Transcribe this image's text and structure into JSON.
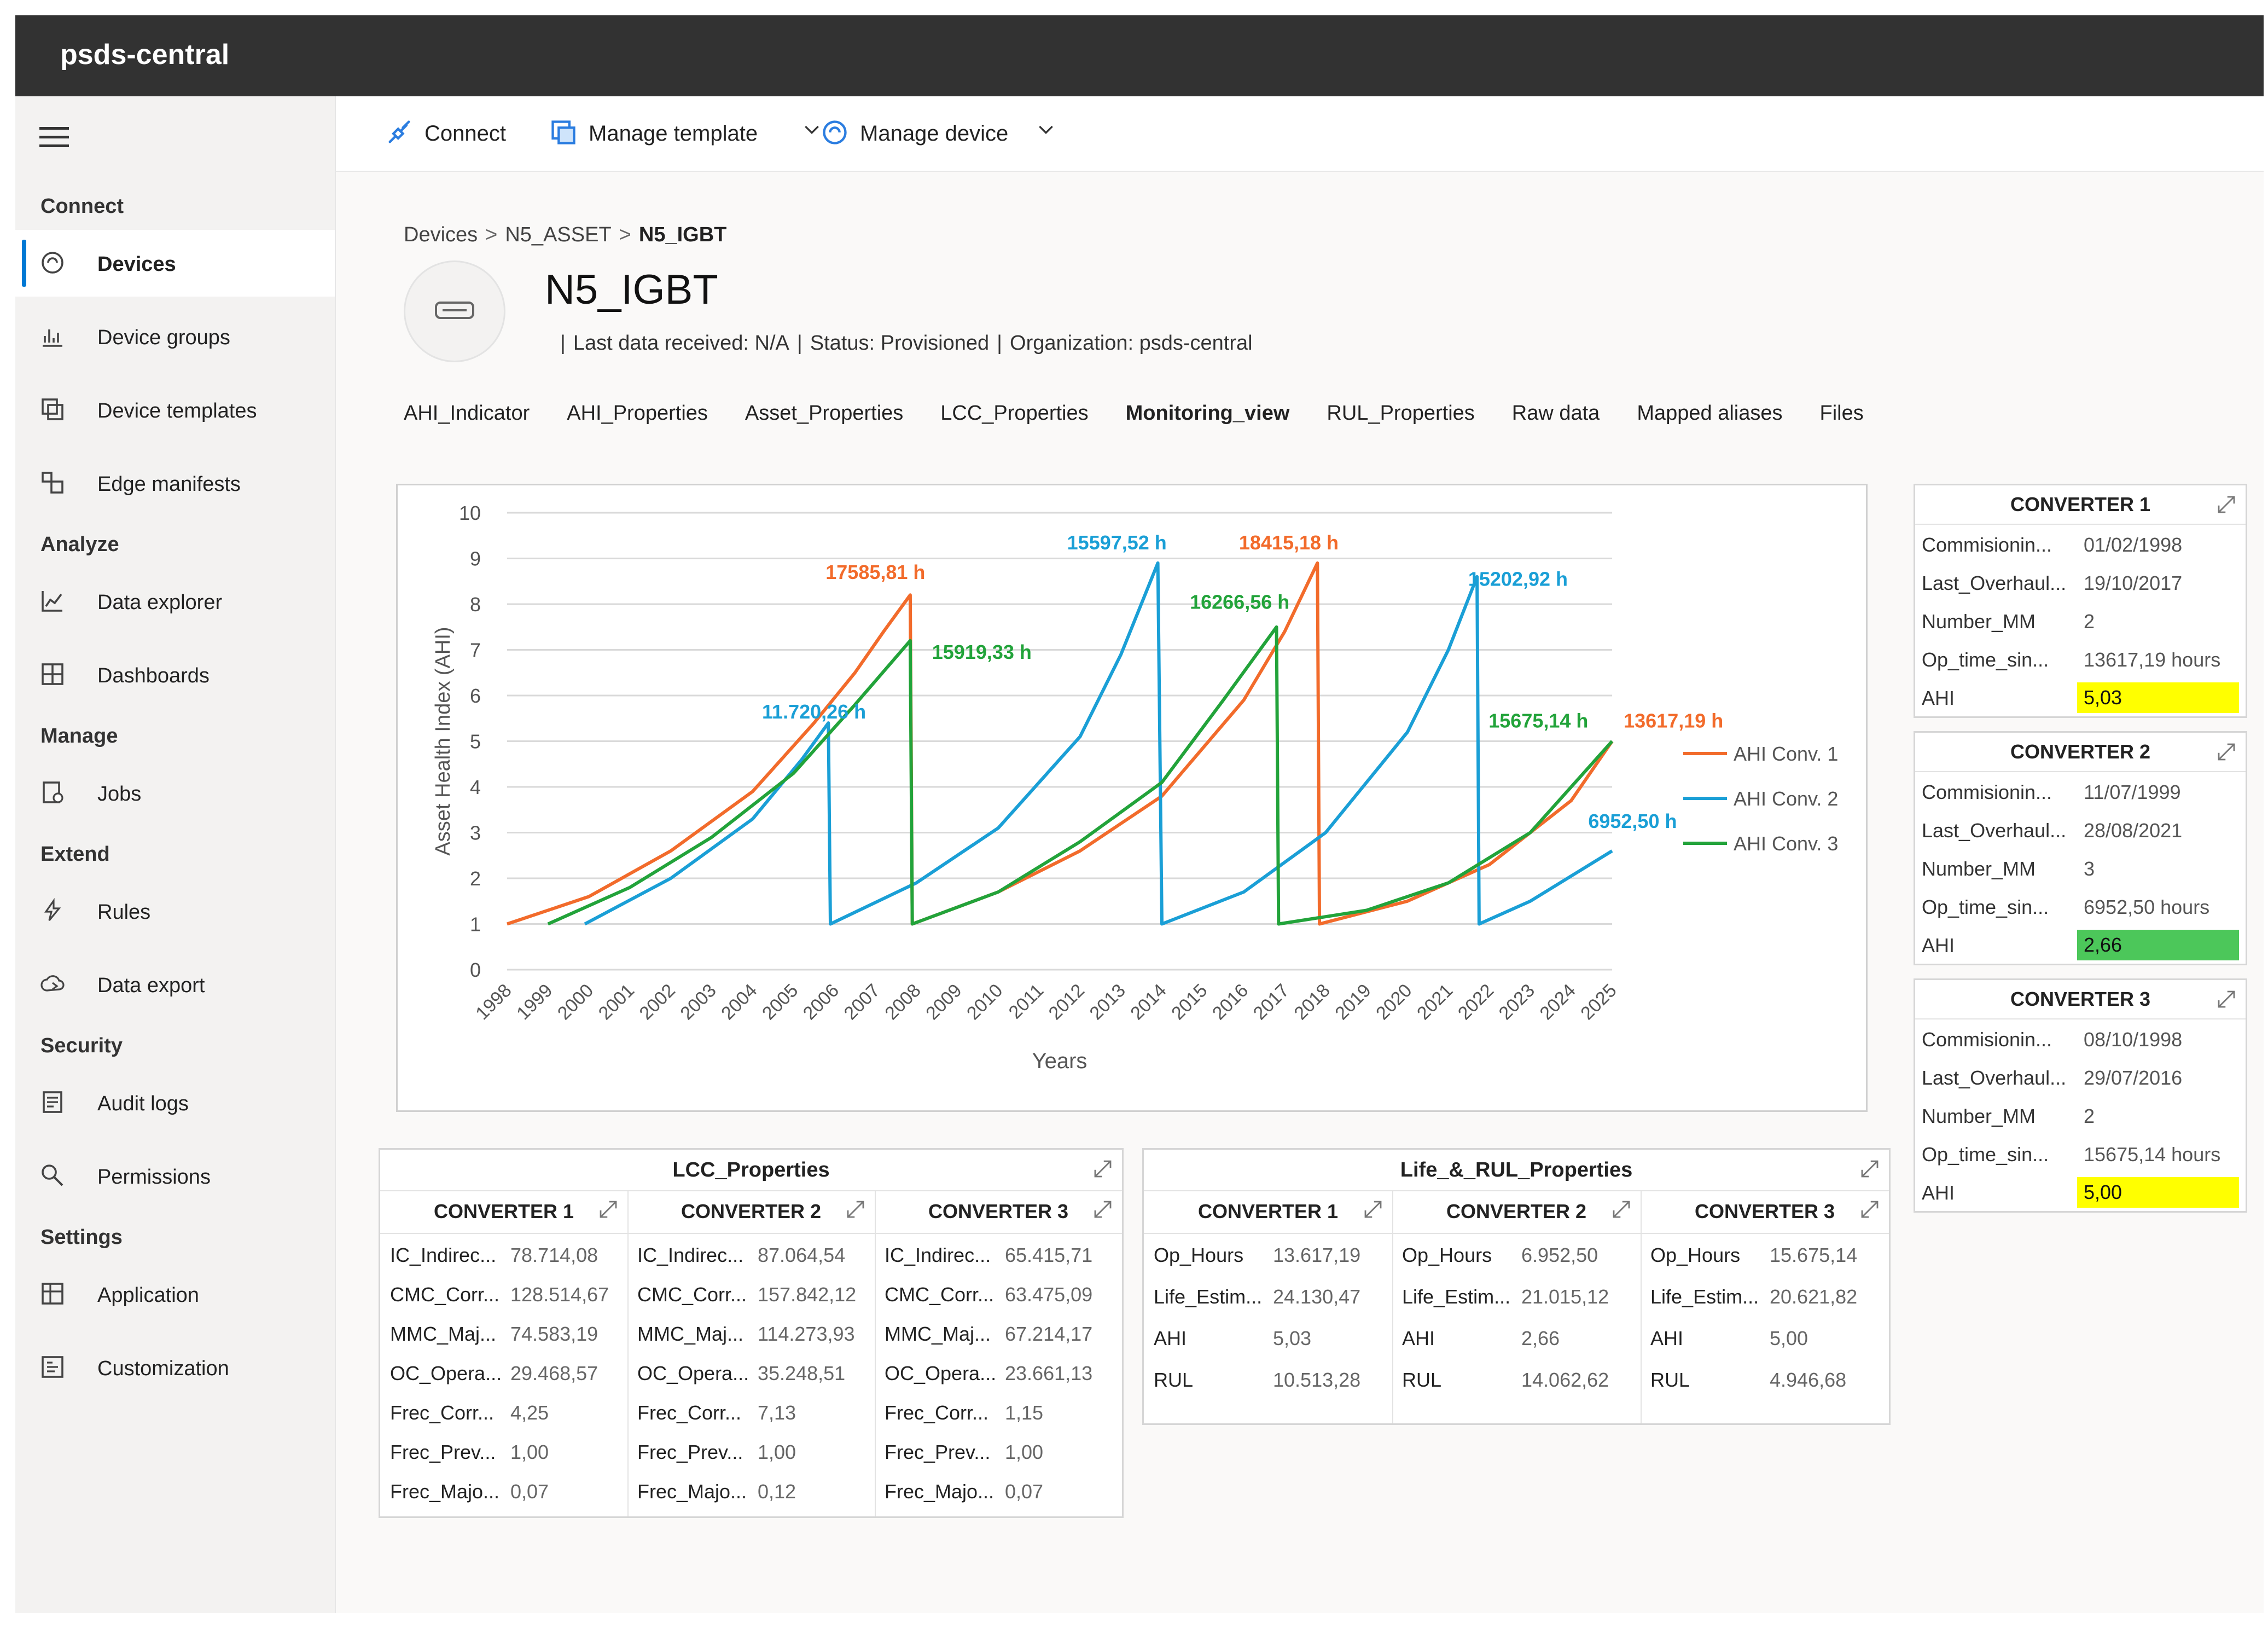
{
  "app": {
    "title": "psds-central"
  },
  "sidebar": {
    "sections": [
      {
        "label": "Connect",
        "items": [
          {
            "label": "Devices",
            "icon": "devices-icon",
            "active": true
          },
          {
            "label": "Device groups",
            "icon": "device-groups-icon"
          },
          {
            "label": "Device templates",
            "icon": "device-templates-icon"
          },
          {
            "label": "Edge manifests",
            "icon": "edge-manifests-icon"
          }
        ]
      },
      {
        "label": "Analyze",
        "items": [
          {
            "label": "Data explorer",
            "icon": "data-explorer-icon"
          },
          {
            "label": "Dashboards",
            "icon": "dashboards-icon"
          }
        ]
      },
      {
        "label": "Manage",
        "items": [
          {
            "label": "Jobs",
            "icon": "jobs-icon"
          }
        ]
      },
      {
        "label": "Extend",
        "items": [
          {
            "label": "Rules",
            "icon": "rules-icon"
          },
          {
            "label": "Data export",
            "icon": "data-export-icon"
          }
        ]
      },
      {
        "label": "Security",
        "items": [
          {
            "label": "Audit logs",
            "icon": "audit-logs-icon"
          },
          {
            "label": "Permissions",
            "icon": "permissions-icon"
          }
        ]
      },
      {
        "label": "Settings",
        "items": [
          {
            "label": "Application",
            "icon": "application-icon"
          },
          {
            "label": "Customization",
            "icon": "customization-icon"
          }
        ]
      }
    ]
  },
  "toolbar": {
    "connect": "Connect",
    "manage_template": "Manage template",
    "manage_device": "Manage device"
  },
  "breadcrumb": {
    "root": "Devices",
    "parent": "N5_ASSET",
    "current": "N5_IGBT"
  },
  "device": {
    "name": "N5_IGBT",
    "last_data": "Last data received: N/A",
    "status": "Status: Provisioned",
    "organization": "Organization: psds-central"
  },
  "tabs": [
    "AHI_Indicator",
    "AHI_Properties",
    "Asset_Properties",
    "LCC_Properties",
    "Monitoring_view",
    "RUL_Properties",
    "Raw data",
    "Mapped aliases",
    "Files"
  ],
  "active_tab": "Monitoring_view",
  "chart_data": {
    "type": "line",
    "ylabel": "Asset Health Index (AHI)",
    "xlabel": "Years",
    "ylim": [
      0,
      10
    ],
    "yticks": [
      0,
      1,
      2,
      3,
      4,
      5,
      6,
      7,
      8,
      9,
      10
    ],
    "xticks": [
      "1998",
      "1999",
      "2000",
      "2001",
      "2002",
      "2003",
      "2004",
      "2005",
      "2006",
      "2007",
      "2008",
      "2009",
      "2010",
      "2011",
      "2012",
      "2013",
      "2014",
      "2015",
      "2016",
      "2017",
      "2018",
      "2019",
      "2020",
      "2021",
      "2022",
      "2023",
      "2024",
      "2025"
    ],
    "grid": "horizontal",
    "legend_position": "right",
    "series": [
      {
        "name": "AHI Conv. 1",
        "color": "#f26b2b",
        "points": [
          [
            1998.0,
            1.0
          ],
          [
            2000.0,
            1.6
          ],
          [
            2002.0,
            2.6
          ],
          [
            2004.0,
            3.9
          ],
          [
            2005.5,
            5.4
          ],
          [
            2006.5,
            6.5
          ],
          [
            2007.2,
            7.4
          ],
          [
            2007.85,
            8.2
          ],
          [
            2007.9,
            1.0
          ],
          [
            2010.0,
            1.7
          ],
          [
            2012.0,
            2.6
          ],
          [
            2014.0,
            3.8
          ],
          [
            2016.0,
            5.9
          ],
          [
            2017.0,
            7.4
          ],
          [
            2017.8,
            8.9
          ],
          [
            2017.85,
            1.0
          ],
          [
            2020.0,
            1.5
          ],
          [
            2022.0,
            2.3
          ],
          [
            2024.0,
            3.7
          ],
          [
            2025.0,
            5.0
          ]
        ]
      },
      {
        "name": "AHI Conv. 2",
        "color": "#1a9fd6",
        "points": [
          [
            1999.9,
            1.0
          ],
          [
            2002.0,
            2.0
          ],
          [
            2004.0,
            3.3
          ],
          [
            2005.2,
            4.6
          ],
          [
            2005.85,
            5.4
          ],
          [
            2005.9,
            1.0
          ],
          [
            2008.0,
            1.9
          ],
          [
            2010.0,
            3.1
          ],
          [
            2012.0,
            5.1
          ],
          [
            2013.0,
            6.9
          ],
          [
            2013.9,
            8.9
          ],
          [
            2014.0,
            1.0
          ],
          [
            2016.0,
            1.7
          ],
          [
            2018.0,
            3.0
          ],
          [
            2020.0,
            5.2
          ],
          [
            2021.0,
            7.0
          ],
          [
            2021.7,
            8.6
          ],
          [
            2021.75,
            1.0
          ],
          [
            2023.0,
            1.5
          ],
          [
            2025.0,
            2.6
          ]
        ]
      },
      {
        "name": "AHI Conv. 3",
        "color": "#22a33a",
        "points": [
          [
            1999.0,
            1.0
          ],
          [
            2001.0,
            1.8
          ],
          [
            2003.0,
            2.9
          ],
          [
            2005.0,
            4.3
          ],
          [
            2006.5,
            5.8
          ],
          [
            2007.85,
            7.2
          ],
          [
            2007.9,
            1.0
          ],
          [
            2010.0,
            1.7
          ],
          [
            2012.0,
            2.8
          ],
          [
            2014.0,
            4.1
          ],
          [
            2015.5,
            5.9
          ],
          [
            2016.8,
            7.5
          ],
          [
            2016.85,
            1.0
          ],
          [
            2019.0,
            1.3
          ],
          [
            2021.0,
            1.9
          ],
          [
            2023.0,
            3.0
          ],
          [
            2025.0,
            5.0
          ]
        ]
      }
    ],
    "annotations": [
      {
        "text": "11.720,26 h",
        "x": 2005.5,
        "y": 5.5,
        "color": "#1a9fd6"
      },
      {
        "text": "17585,81 h",
        "x": 2007.0,
        "y": 8.55,
        "color": "#f26b2b"
      },
      {
        "text": "15919,33 h",
        "x": 2009.6,
        "y": 6.8,
        "color": "#22a33a"
      },
      {
        "text": "15597,52 h",
        "x": 2012.9,
        "y": 9.2,
        "color": "#1a9fd6"
      },
      {
        "text": "16266,56 h",
        "x": 2015.9,
        "y": 7.9,
        "color": "#22a33a"
      },
      {
        "text": "18415,18 h",
        "x": 2017.1,
        "y": 9.2,
        "color": "#f26b2b"
      },
      {
        "text": "15202,92 h",
        "x": 2022.7,
        "y": 8.4,
        "color": "#1a9fd6"
      },
      {
        "text": "15675,14 h",
        "x": 2023.2,
        "y": 5.3,
        "color": "#22a33a"
      },
      {
        "text": "13617,19 h",
        "x": 2026.5,
        "y": 5.3,
        "color": "#f26b2b"
      },
      {
        "text": "6952,50 h",
        "x": 2025.5,
        "y": 3.1,
        "color": "#1a9fd6"
      }
    ]
  },
  "converters": [
    {
      "title": "CONVERTER 1",
      "rows": [
        {
          "k": "Commisionin...",
          "v": "01/02/1998"
        },
        {
          "k": "Last_Overhaul...",
          "v": "19/10/2017"
        },
        {
          "k": "Number_MM",
          "v": "2"
        },
        {
          "k": "Op_time_sin...",
          "v": "13617,19 hours"
        }
      ],
      "ahi_label": "AHI",
      "ahi": "5,03",
      "ahi_color": "#ffff00"
    },
    {
      "title": "CONVERTER 2",
      "rows": [
        {
          "k": "Commisionin...",
          "v": "11/07/1999"
        },
        {
          "k": "Last_Overhaul...",
          "v": "28/08/2021"
        },
        {
          "k": "Number_MM",
          "v": "3"
        },
        {
          "k": "Op_time_sin...",
          "v": "6952,50 hours"
        }
      ],
      "ahi_label": "AHI",
      "ahi": "2,66",
      "ahi_color": "#4cc75a"
    },
    {
      "title": "CONVERTER 3",
      "rows": [
        {
          "k": "Commisionin...",
          "v": "08/10/1998"
        },
        {
          "k": "Last_Overhaul...",
          "v": "29/07/2016"
        },
        {
          "k": "Number_MM",
          "v": "2"
        },
        {
          "k": "Op_time_sin...",
          "v": "15675,14 hours"
        }
      ],
      "ahi_label": "AHI",
      "ahi": "5,00",
      "ahi_color": "#ffff00"
    }
  ],
  "lcc": {
    "title": "LCC_Properties",
    "columns": [
      {
        "title": "CONVERTER 1",
        "rows": [
          {
            "k": "IC_Indirec...",
            "v": "78.714,08"
          },
          {
            "k": "CMC_Corr...",
            "v": "128.514,67"
          },
          {
            "k": "MMC_Maj...",
            "v": "74.583,19"
          },
          {
            "k": "OC_Opera...",
            "v": "29.468,57"
          },
          {
            "k": "Frec_Corr...",
            "v": "4,25"
          },
          {
            "k": "Frec_Prev...",
            "v": "1,00"
          },
          {
            "k": "Frec_Majo...",
            "v": "0,07"
          }
        ]
      },
      {
        "title": "CONVERTER 2",
        "rows": [
          {
            "k": "IC_Indirec...",
            "v": "87.064,54"
          },
          {
            "k": "CMC_Corr...",
            "v": "157.842,12"
          },
          {
            "k": "MMC_Maj...",
            "v": "114.273,93"
          },
          {
            "k": "OC_Opera...",
            "v": "35.248,51"
          },
          {
            "k": "Frec_Corr...",
            "v": "7,13"
          },
          {
            "k": "Frec_Prev...",
            "v": "1,00"
          },
          {
            "k": "Frec_Majo...",
            "v": "0,12"
          }
        ]
      },
      {
        "title": "CONVERTER 3",
        "rows": [
          {
            "k": "IC_Indirec...",
            "v": "65.415,71"
          },
          {
            "k": "CMC_Corr...",
            "v": "63.475,09"
          },
          {
            "k": "MMC_Maj...",
            "v": "67.214,17"
          },
          {
            "k": "OC_Opera...",
            "v": "23.661,13"
          },
          {
            "k": "Frec_Corr...",
            "v": "1,15"
          },
          {
            "k": "Frec_Prev...",
            "v": "1,00"
          },
          {
            "k": "Frec_Majo...",
            "v": "0,07"
          }
        ]
      }
    ]
  },
  "rul": {
    "title": "Life_&_RUL_Properties",
    "columns": [
      {
        "title": "CONVERTER 1",
        "rows": [
          {
            "k": "Op_Hours",
            "v": "13.617,19"
          },
          {
            "k": "Life_Estim...",
            "v": "24.130,47"
          },
          {
            "k": "AHI",
            "v": "5,03"
          },
          {
            "k": "RUL",
            "v": "10.513,28"
          }
        ]
      },
      {
        "title": "CONVERTER 2",
        "rows": [
          {
            "k": "Op_Hours",
            "v": "6.952,50"
          },
          {
            "k": "Life_Estim...",
            "v": "21.015,12"
          },
          {
            "k": "AHI",
            "v": "2,66"
          },
          {
            "k": "RUL",
            "v": "14.062,62"
          }
        ]
      },
      {
        "title": "CONVERTER 3",
        "rows": [
          {
            "k": "Op_Hours",
            "v": "15.675,14"
          },
          {
            "k": "Life_Estim...",
            "v": "20.621,82"
          },
          {
            "k": "AHI",
            "v": "5,00"
          },
          {
            "k": "RUL",
            "v": "4.946,68"
          }
        ]
      }
    ]
  }
}
